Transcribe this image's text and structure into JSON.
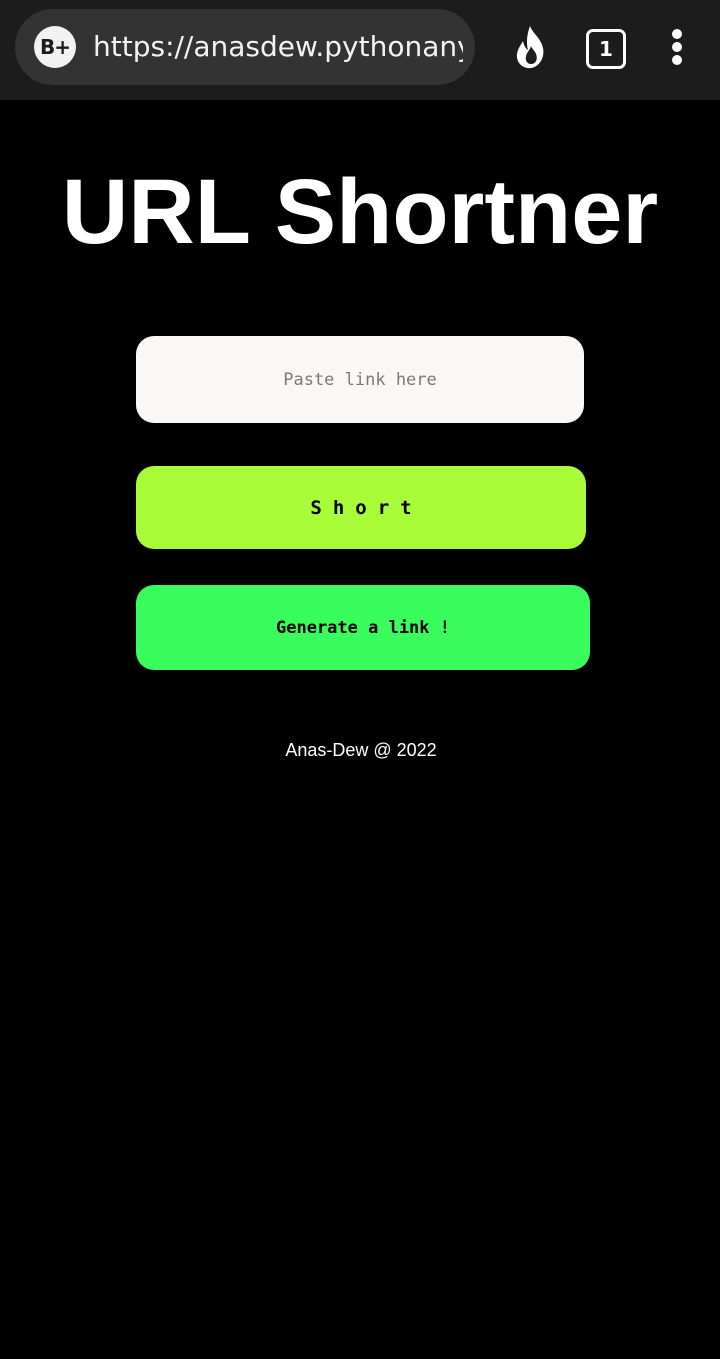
{
  "browser": {
    "site_badge": "B+",
    "url": "https://anasdew.pythonanywhere.com/",
    "tab_count": "1",
    "icons": [
      "flame-icon",
      "tabs-icon",
      "overflow-menu-icon"
    ]
  },
  "page": {
    "title": "URL Shortner",
    "link_input": {
      "value": "",
      "placeholder": "Paste link here"
    },
    "short_button_label": "Short",
    "generate_button_label": "Generate a link !",
    "footer": "Anas-Dew @ 2022"
  },
  "colors": {
    "background": "#000000",
    "browser_bar": "#1c1c1c",
    "url_pill": "#333333",
    "input_bg": "#faf8f5",
    "short_button": "#a8fc38",
    "generate_button": "#38fd5c",
    "title_text": "#ffffff"
  }
}
